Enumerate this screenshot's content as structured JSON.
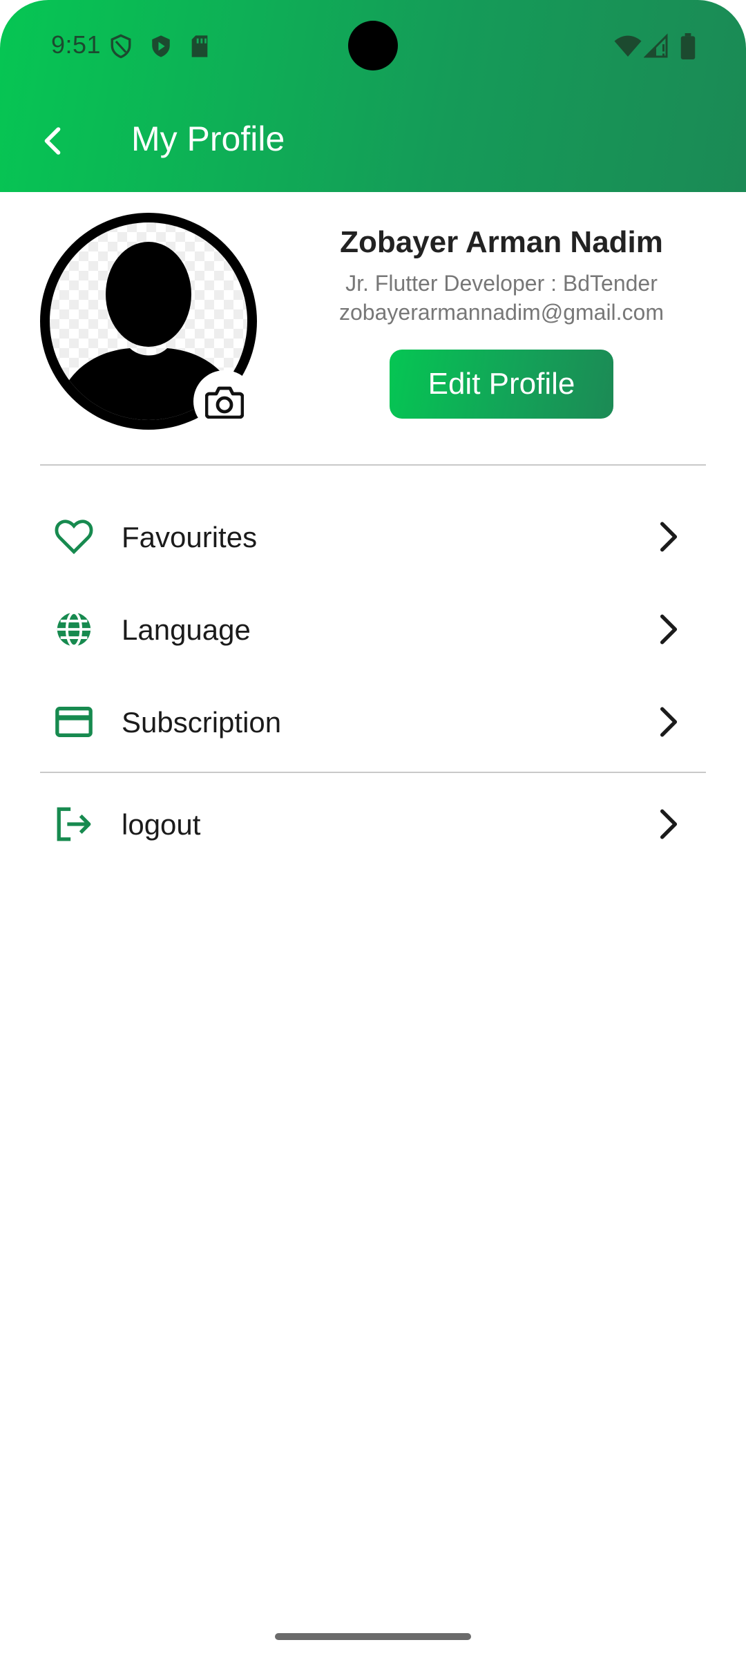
{
  "status_bar": {
    "time": "9:51"
  },
  "appbar": {
    "title": "My Profile",
    "back_icon": "arrow-back-icon"
  },
  "profile": {
    "name": "Zobayer Arman Nadim",
    "role": "Jr. Flutter Developer : BdTender",
    "email": "zobayerarmannadim@gmail.com",
    "edit_button": "Edit Profile",
    "avatar_icon": "person-avatar-icon",
    "camera_icon": "camera-icon"
  },
  "menu": {
    "items": [
      {
        "label": "Favourites",
        "icon": "heart-icon"
      },
      {
        "label": "Language",
        "icon": "globe-icon"
      },
      {
        "label": "Subscription",
        "icon": "credit-card-icon"
      }
    ],
    "logout": {
      "label": "logout",
      "icon": "logout-icon"
    }
  },
  "colors": {
    "primary": "#06c653",
    "primary_dark": "#1b8a55",
    "icon_green": "#178a4f"
  }
}
